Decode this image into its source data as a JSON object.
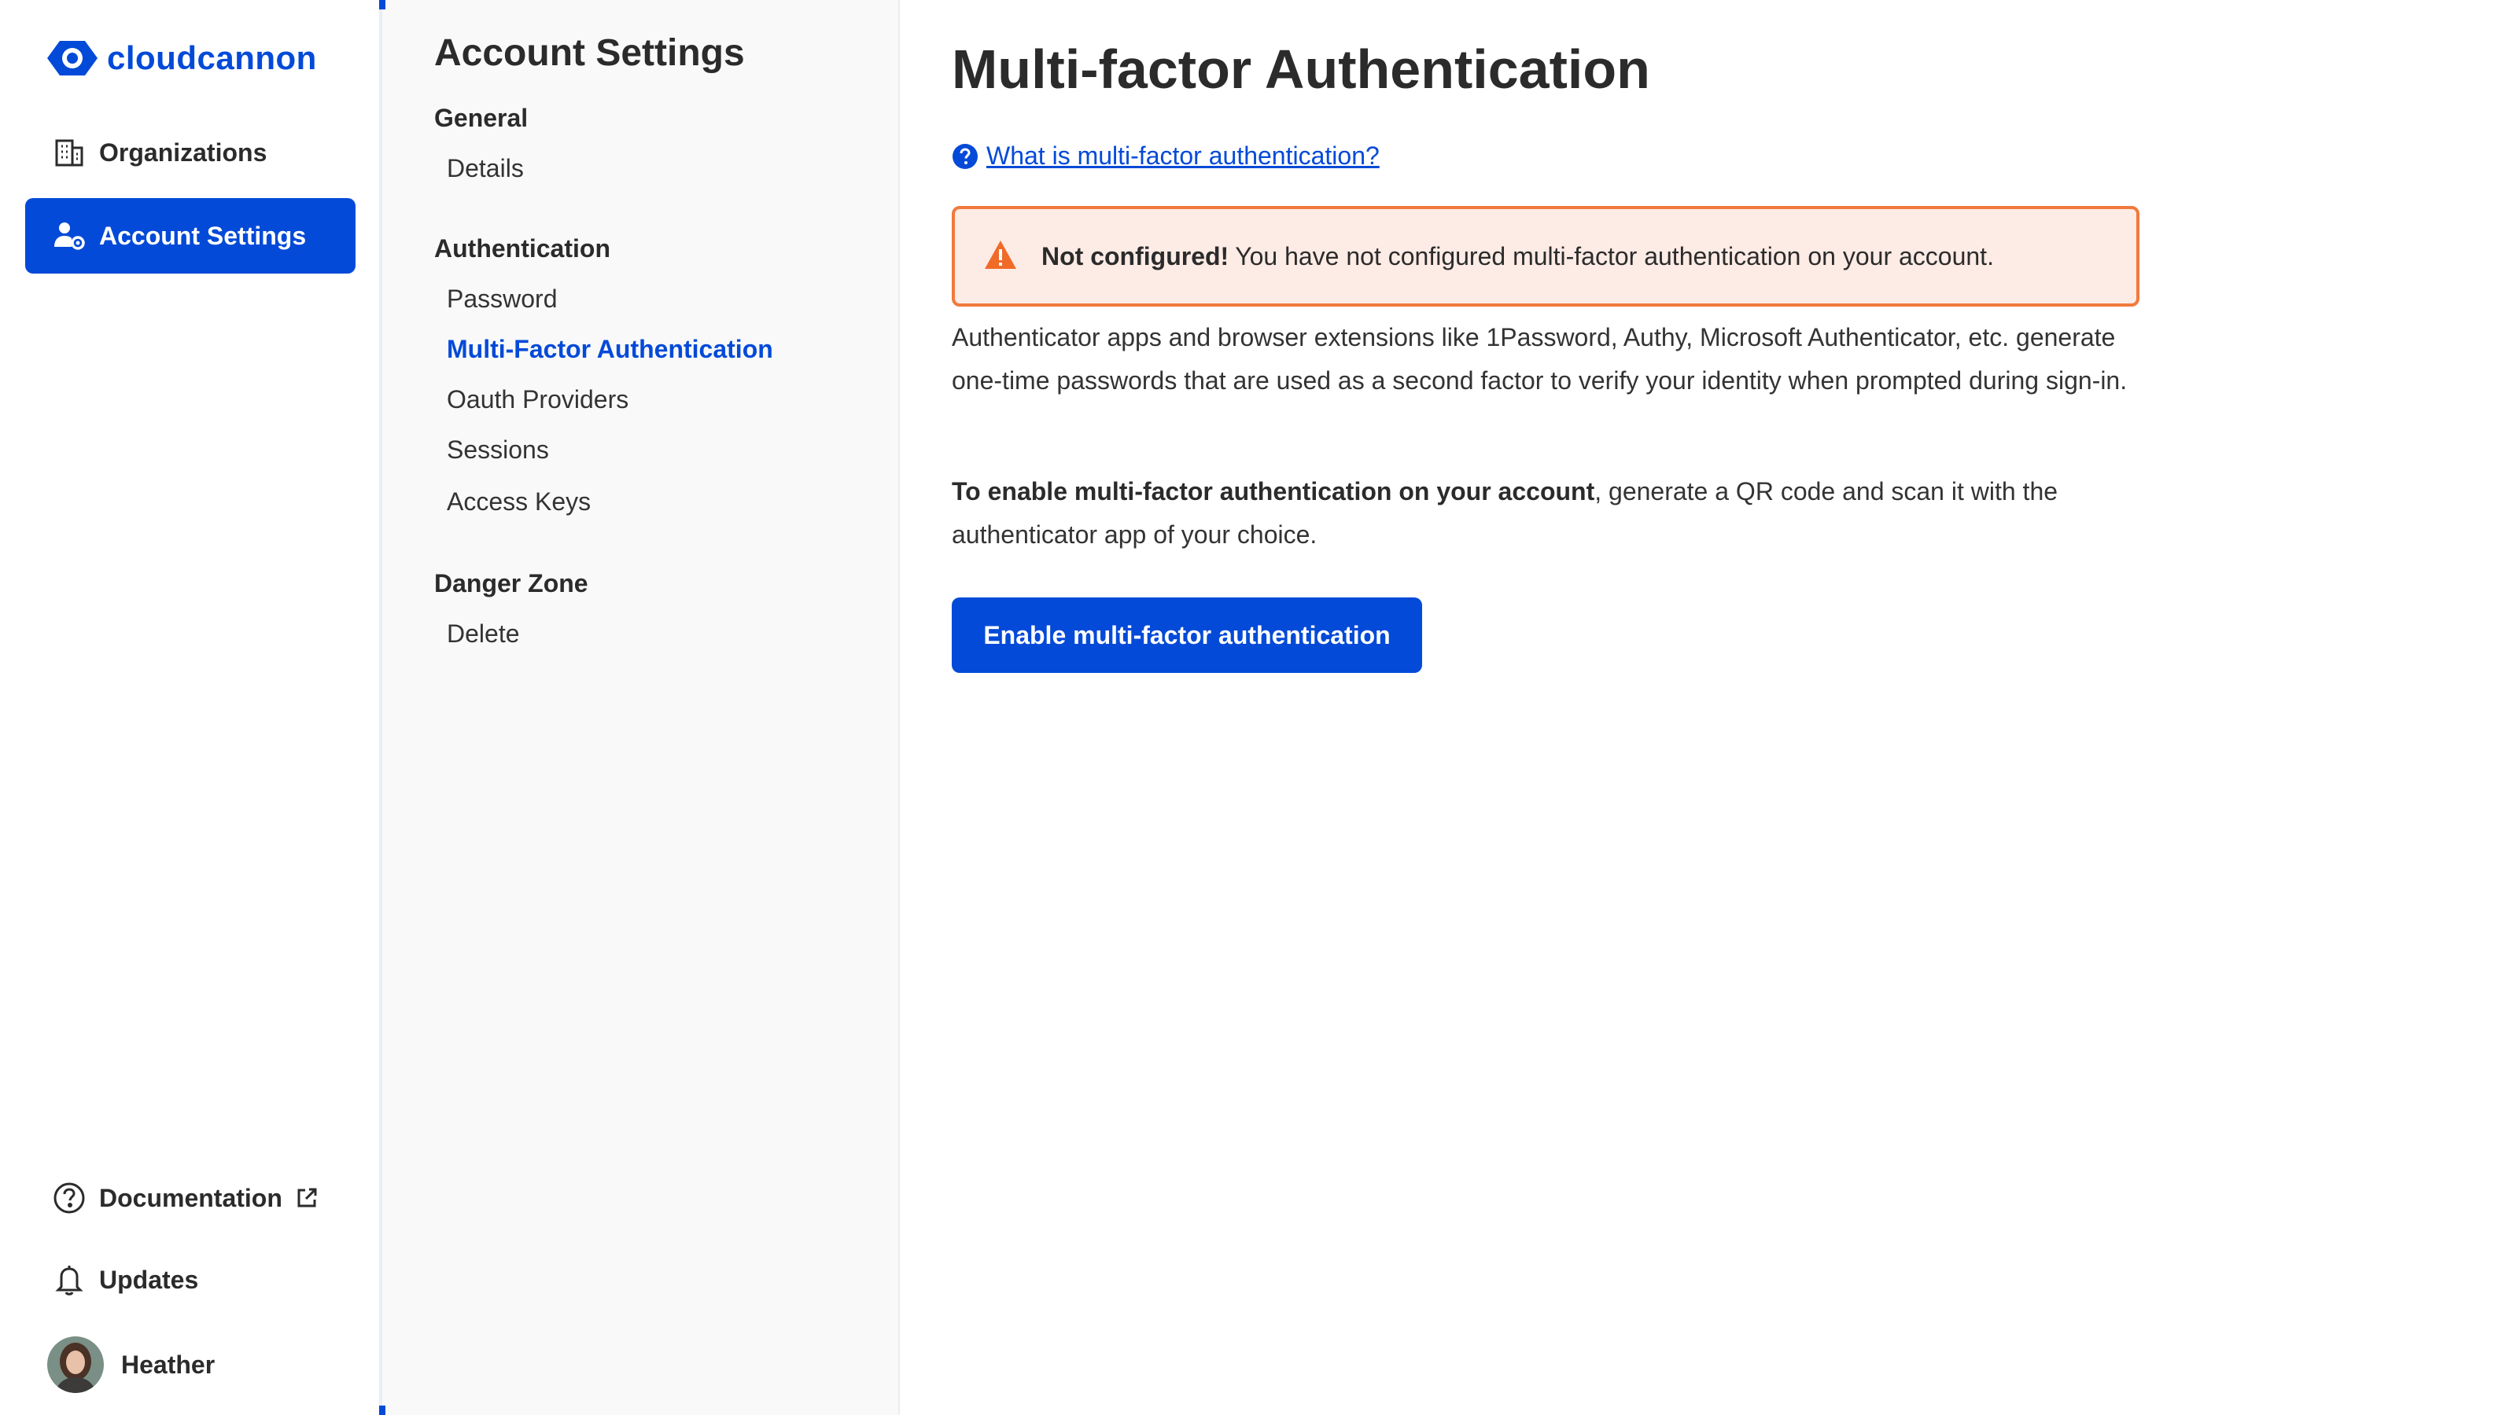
{
  "brand": {
    "name": "cloudcannon",
    "color": "#034ad8"
  },
  "nav": {
    "items": [
      {
        "label": "Organizations",
        "icon": "building-icon",
        "active": false
      },
      {
        "label": "Account Settings",
        "icon": "user-gear-icon",
        "active": true
      }
    ],
    "bottom": [
      {
        "label": "Documentation",
        "icon": "help-circle-icon",
        "trailing_icon": "external-link-icon"
      },
      {
        "label": "Updates",
        "icon": "bell-icon"
      },
      {
        "label": "Heather",
        "icon": "avatar"
      }
    ]
  },
  "settings": {
    "title": "Account Settings",
    "groups": [
      {
        "heading": "General",
        "links": [
          "Details"
        ]
      },
      {
        "heading": "Authentication",
        "links": [
          "Password",
          "Multi-Factor Authentication",
          "Oauth Providers",
          "Sessions",
          "Access Keys"
        ]
      },
      {
        "heading": "Danger Zone",
        "links": [
          "Delete"
        ]
      }
    ],
    "active_link": "Multi-Factor Authentication"
  },
  "main": {
    "title": "Multi-factor Authentication",
    "help_link": "What is multi-factor authentication?",
    "alert": {
      "strong": "Not configured!",
      "text": "You have not configured multi-factor authentication on your account.",
      "border_color": "#f07a3c",
      "background": "#fdebe5"
    },
    "paragraph1": "Authenticator apps and browser extensions like 1Password, Authy, Microsoft Authenticator, etc. generate one-time passwords that are used as a second factor to verify your identity when prompted during sign-in.",
    "paragraph2_strong": "To enable multi-factor authentication on your account",
    "paragraph2_rest": ", generate a QR code and scan it with the authenticator app of your choice.",
    "enable_button": "Enable multi-factor authentication"
  }
}
